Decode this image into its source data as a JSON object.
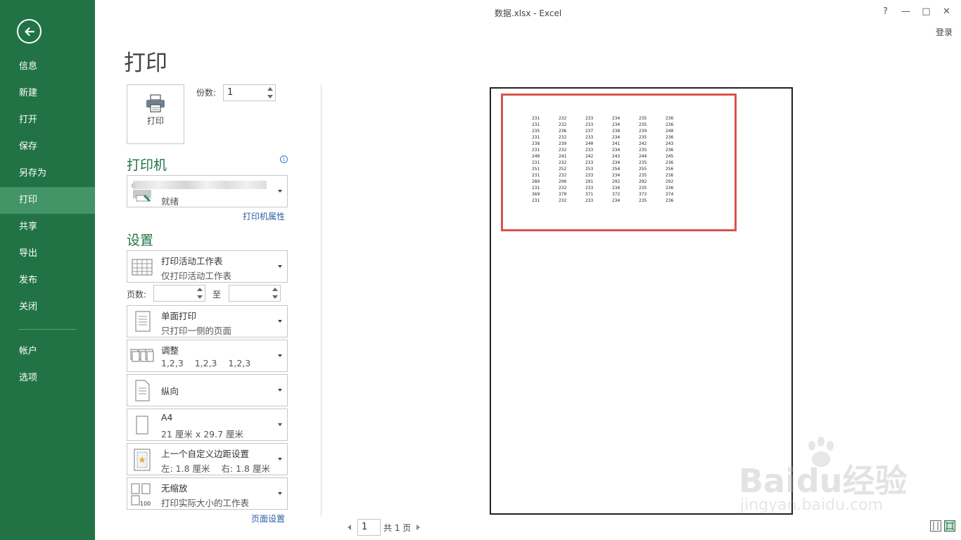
{
  "window": {
    "title": "数据.xlsx - Excel",
    "help": "?",
    "minimize": "—",
    "restore": "□",
    "close": "✕",
    "login": "登录"
  },
  "sidebar": {
    "items": [
      {
        "label": "信息"
      },
      {
        "label": "新建"
      },
      {
        "label": "打开"
      },
      {
        "label": "保存"
      },
      {
        "label": "另存为"
      },
      {
        "label": "打印"
      },
      {
        "label": "共享"
      },
      {
        "label": "导出"
      },
      {
        "label": "发布"
      },
      {
        "label": "关闭"
      }
    ],
    "bottom_items": [
      {
        "label": "帐户"
      },
      {
        "label": "选项"
      }
    ],
    "active": "打印"
  },
  "print": {
    "title": "打印",
    "button_label": "打印",
    "copies_label": "份数:",
    "copies_value": "1"
  },
  "printer": {
    "heading": "打印机",
    "status": "就绪",
    "properties_link": "打印机属性"
  },
  "settings": {
    "heading": "设置",
    "scope": {
      "line1": "打印活动工作表",
      "line2": "仅打印活动工作表"
    },
    "pages_label": "页数:",
    "to_label": "至",
    "pages_from": "",
    "pages_to": "",
    "sides": {
      "line1": "单面打印",
      "line2": "只打印一侧的页面"
    },
    "collate": {
      "line1": "调整",
      "line2": "1,2,3    1,2,3    1,2,3"
    },
    "orientation": {
      "line1": "纵向"
    },
    "paper": {
      "line1": "A4",
      "line2": "21 厘米 x 29.7 厘米"
    },
    "margins": {
      "line1": "上一个自定义边距设置",
      "line2": "左: 1.8 厘米    右: 1.8 厘米"
    },
    "scaling": {
      "line1": "无缩放",
      "line2": "打印实际大小的工作表"
    },
    "page_setup_link": "页面设置"
  },
  "preview": {
    "rows": [
      [
        "231",
        "232",
        "233",
        "234",
        "235",
        "236"
      ],
      [
        "231",
        "232",
        "233",
        "234",
        "235",
        "236"
      ],
      [
        "235",
        "236",
        "237",
        "238",
        "239",
        "240"
      ],
      [
        "231",
        "232",
        "233",
        "234",
        "235",
        "236"
      ],
      [
        "238",
        "239",
        "240",
        "241",
        "242",
        "243"
      ],
      [
        "231",
        "232",
        "233",
        "234",
        "235",
        "236"
      ],
      [
        "240",
        "241",
        "242",
        "243",
        "244",
        "245"
      ],
      [
        "231",
        "232",
        "233",
        "234",
        "235",
        "236"
      ],
      [
        "251",
        "252",
        "253",
        "254",
        "255",
        "256"
      ],
      [
        "231",
        "232",
        "233",
        "234",
        "235",
        "236"
      ],
      [
        "289",
        "290",
        "291",
        "292",
        "292",
        "292"
      ],
      [
        "231",
        "232",
        "233",
        "234",
        "235",
        "236"
      ],
      [
        "369",
        "370",
        "371",
        "372",
        "373",
        "374"
      ],
      [
        "231",
        "232",
        "233",
        "234",
        "235",
        "236"
      ]
    ],
    "highlight_color": "#d9534f"
  },
  "pager": {
    "current": "1",
    "total_text": "共 1 页"
  },
  "watermark": {
    "brand": "Baidu经验",
    "url": "jingyan.baidu.com"
  },
  "colors": {
    "sidebar": "#217346",
    "sidebar_active": "#439467",
    "heading": "#217346"
  }
}
